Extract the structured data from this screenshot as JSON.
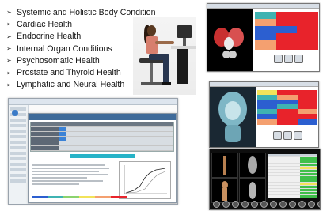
{
  "conditions": [
    "Systemic and Holistic Body Condition",
    "Cardiac Health",
    "Endocrine Health",
    "Internal Organ Conditions",
    "Psychosomatic Health",
    "Prostate and Thyroid Health",
    "Lymphatic and Neural Health"
  ],
  "bullet_marker": "➢",
  "colors": {
    "dialog_header": "#3f6b9a",
    "accent_cyan": "#27b3c7",
    "accent_blue": "#3b82d6",
    "heatmap_red": "#e8232b",
    "heatmap_orange": "#f4a070",
    "heatmap_teal": "#3fb3b2",
    "heatmap_blue": "#2c5fd0"
  }
}
